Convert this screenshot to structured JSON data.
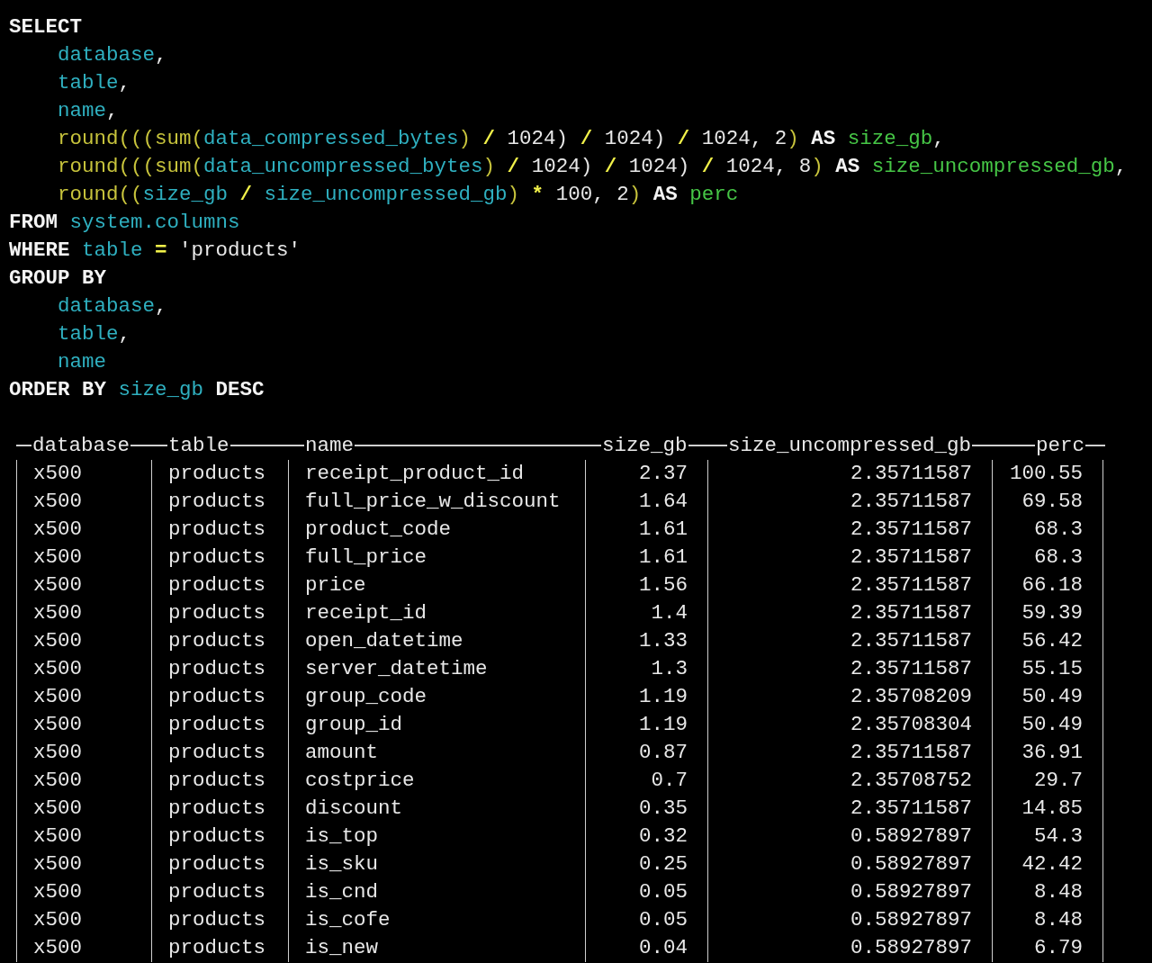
{
  "query": [
    {
      "indented": false,
      "tokens": [
        {
          "kind": "kw",
          "text": "SELECT"
        }
      ]
    },
    {
      "indented": true,
      "tokens": [
        {
          "kind": "id",
          "text": "database"
        },
        {
          "kind": "plain",
          "text": ","
        }
      ]
    },
    {
      "indented": true,
      "tokens": [
        {
          "kind": "id",
          "text": "table"
        },
        {
          "kind": "plain",
          "text": ","
        }
      ]
    },
    {
      "indented": true,
      "tokens": [
        {
          "kind": "id",
          "text": "name"
        },
        {
          "kind": "plain",
          "text": ","
        }
      ]
    },
    {
      "indented": true,
      "tokens": [
        {
          "kind": "fn",
          "text": "round(((sum("
        },
        {
          "kind": "id",
          "text": "data_compressed_bytes"
        },
        {
          "kind": "fn",
          "text": ")"
        },
        {
          "kind": "op",
          "text": " / "
        },
        {
          "kind": "plain",
          "text": "1024)"
        },
        {
          "kind": "op",
          "text": " / "
        },
        {
          "kind": "plain",
          "text": "1024)"
        },
        {
          "kind": "op",
          "text": " / "
        },
        {
          "kind": "plain",
          "text": "1024, 2"
        },
        {
          "kind": "fn",
          "text": ")"
        },
        {
          "kind": "kw",
          "text": " AS "
        },
        {
          "kind": "alias",
          "text": "size_gb"
        },
        {
          "kind": "plain",
          "text": ","
        }
      ]
    },
    {
      "indented": true,
      "tokens": [
        {
          "kind": "fn",
          "text": "round(((sum("
        },
        {
          "kind": "id",
          "text": "data_uncompressed_bytes"
        },
        {
          "kind": "fn",
          "text": ")"
        },
        {
          "kind": "op",
          "text": " / "
        },
        {
          "kind": "plain",
          "text": "1024)"
        },
        {
          "kind": "op",
          "text": " / "
        },
        {
          "kind": "plain",
          "text": "1024)"
        },
        {
          "kind": "op",
          "text": " / "
        },
        {
          "kind": "plain",
          "text": "1024, 8"
        },
        {
          "kind": "fn",
          "text": ")"
        },
        {
          "kind": "kw",
          "text": " AS "
        },
        {
          "kind": "alias",
          "text": "size_uncompressed_gb"
        },
        {
          "kind": "plain",
          "text": ","
        }
      ]
    },
    {
      "indented": true,
      "tokens": [
        {
          "kind": "fn",
          "text": "round(("
        },
        {
          "kind": "id",
          "text": "size_gb"
        },
        {
          "kind": "op",
          "text": " / "
        },
        {
          "kind": "id",
          "text": "size_uncompressed_gb"
        },
        {
          "kind": "fn",
          "text": ")"
        },
        {
          "kind": "op",
          "text": " * "
        },
        {
          "kind": "plain",
          "text": "100, 2"
        },
        {
          "kind": "fn",
          "text": ")"
        },
        {
          "kind": "kw",
          "text": " AS "
        },
        {
          "kind": "alias",
          "text": "perc"
        }
      ]
    },
    {
      "indented": false,
      "tokens": [
        {
          "kind": "kw",
          "text": "FROM "
        },
        {
          "kind": "id",
          "text": "system.columns"
        }
      ]
    },
    {
      "indented": false,
      "tokens": [
        {
          "kind": "kw",
          "text": "WHERE "
        },
        {
          "kind": "id",
          "text": "table"
        },
        {
          "kind": "op",
          "text": " = "
        },
        {
          "kind": "plain",
          "text": "'products'"
        }
      ]
    },
    {
      "indented": false,
      "tokens": [
        {
          "kind": "kw",
          "text": "GROUP BY"
        }
      ]
    },
    {
      "indented": true,
      "tokens": [
        {
          "kind": "id",
          "text": "database"
        },
        {
          "kind": "plain",
          "text": ","
        }
      ]
    },
    {
      "indented": true,
      "tokens": [
        {
          "kind": "id",
          "text": "table"
        },
        {
          "kind": "plain",
          "text": ","
        }
      ]
    },
    {
      "indented": true,
      "tokens": [
        {
          "kind": "id",
          "text": "name"
        }
      ]
    },
    {
      "indented": false,
      "tokens": [
        {
          "kind": "kw",
          "text": "ORDER BY "
        },
        {
          "kind": "id",
          "text": "size_gb"
        },
        {
          "kind": "kw",
          "text": " DESC"
        }
      ]
    }
  ],
  "table": {
    "columns": [
      "database",
      "table",
      "name",
      "size_gb",
      "size_uncompressed_gb",
      "perc"
    ],
    "rows": [
      [
        "x500",
        "products",
        "receipt_product_id",
        "2.37",
        "2.35711587",
        "100.55"
      ],
      [
        "x500",
        "products",
        "full_price_w_discount",
        "1.64",
        "2.35711587",
        "69.58"
      ],
      [
        "x500",
        "products",
        "product_code",
        "1.61",
        "2.35711587",
        "68.3"
      ],
      [
        "x500",
        "products",
        "full_price",
        "1.61",
        "2.35711587",
        "68.3"
      ],
      [
        "x500",
        "products",
        "price",
        "1.56",
        "2.35711587",
        "66.18"
      ],
      [
        "x500",
        "products",
        "receipt_id",
        "1.4",
        "2.35711587",
        "59.39"
      ],
      [
        "x500",
        "products",
        "open_datetime",
        "1.33",
        "2.35711587",
        "56.42"
      ],
      [
        "x500",
        "products",
        "server_datetime",
        "1.3",
        "2.35711587",
        "55.15"
      ],
      [
        "x500",
        "products",
        "group_code",
        "1.19",
        "2.35708209",
        "50.49"
      ],
      [
        "x500",
        "products",
        "group_id",
        "1.19",
        "2.35708304",
        "50.49"
      ],
      [
        "x500",
        "products",
        "amount",
        "0.87",
        "2.35711587",
        "36.91"
      ],
      [
        "x500",
        "products",
        "costprice",
        "0.7",
        "2.35708752",
        "29.7"
      ],
      [
        "x500",
        "products",
        "discount",
        "0.35",
        "2.35711587",
        "14.85"
      ],
      [
        "x500",
        "products",
        "is_top",
        "0.32",
        "0.58927897",
        "54.3"
      ],
      [
        "x500",
        "products",
        "is_sku",
        "0.25",
        "0.58927897",
        "42.42"
      ],
      [
        "x500",
        "products",
        "is_cnd",
        "0.05",
        "0.58927897",
        "8.48"
      ],
      [
        "x500",
        "products",
        "is_cofe",
        "0.05",
        "0.58927897",
        "8.48"
      ],
      [
        "x500",
        "products",
        "is_new",
        "0.04",
        "0.58927897",
        "6.79"
      ]
    ]
  }
}
